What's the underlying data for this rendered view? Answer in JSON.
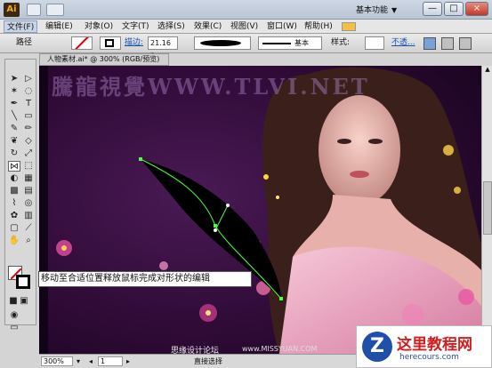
{
  "app": {
    "logo": "Ai",
    "workspace": "基本功能"
  },
  "window_buttons": [
    "—",
    "□",
    "×"
  ],
  "menu": [
    {
      "label": "文件(F)"
    },
    {
      "label": "编辑(E)"
    },
    {
      "label": "对象(O)"
    },
    {
      "label": "文字(T)"
    },
    {
      "label": "选择(S)"
    },
    {
      "label": "效果(C)"
    },
    {
      "label": "视图(V)"
    },
    {
      "label": "窗口(W)"
    },
    {
      "label": "帮助(H)"
    }
  ],
  "control": {
    "object_type": "路径",
    "stroke_label": "描边:",
    "stroke_weight": "21.16 p",
    "brush_label": "基本",
    "opacity_label": "样式:",
    "extra_label": "不透..."
  },
  "document": {
    "tab_title": "人物素材.ai* @ 300% (RGB/预览)"
  },
  "tooltip": "移动至合适位置释放鼠标完成对形状的编辑",
  "watermark": "騰龍視覺WWW.TLVI.NET",
  "status": {
    "zoom": "300%",
    "page": "1",
    "mode": "直接选择"
  },
  "credit": "思缘设计论坛",
  "credit_url": "www.MISSYUAN.COM",
  "badge": {
    "title": "这里教程网",
    "url": "herecours.com",
    "logo_letter": "Z"
  },
  "colors": {
    "accent": "#f5a623",
    "canvas_bg": "#3a0f3a",
    "path": "#4cff3c",
    "badge_red": "#d31d1d"
  }
}
